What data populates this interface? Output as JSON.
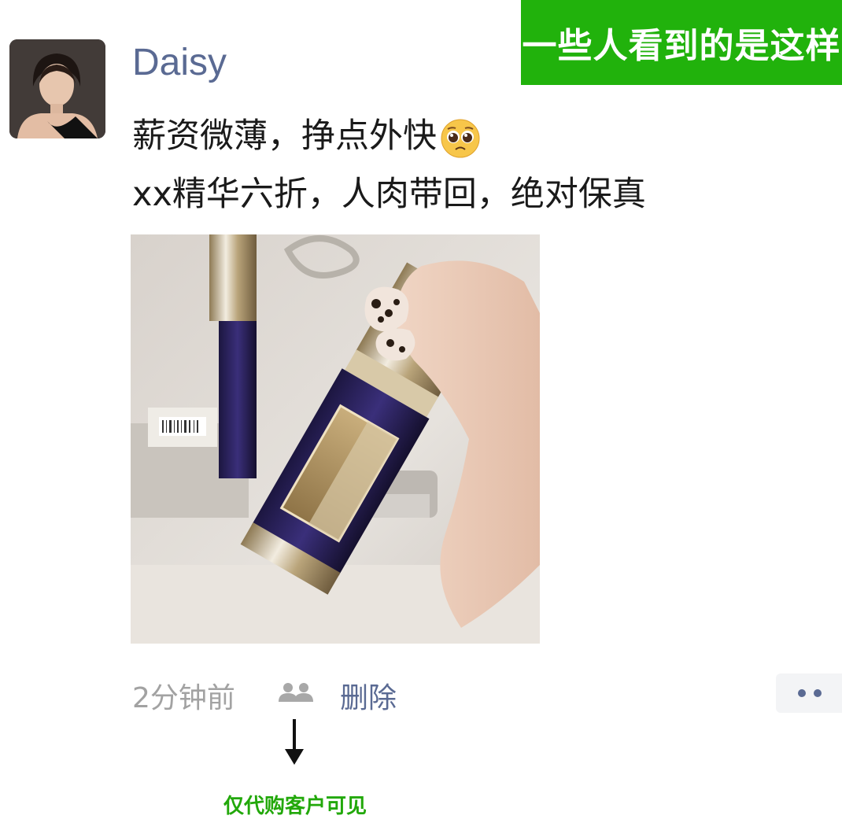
{
  "banner": {
    "text": "一些人看到的是这样"
  },
  "post": {
    "author": "Daisy",
    "line1": "薪资微薄，挣点外快",
    "line2": "xx精华六折，人肉带回，绝对保真",
    "time": "2分钟前",
    "delete_label": "删除"
  },
  "annotation": {
    "caption": "仅代购客户可见"
  },
  "icons": {
    "emoji": "pleading-face-icon",
    "visibility": "people-icon",
    "more": "more-dots-icon",
    "arrow": "arrow-down-icon"
  },
  "colors": {
    "banner_bg": "#21b20c",
    "link": "#5a6a93",
    "caption": "#22a80a"
  }
}
